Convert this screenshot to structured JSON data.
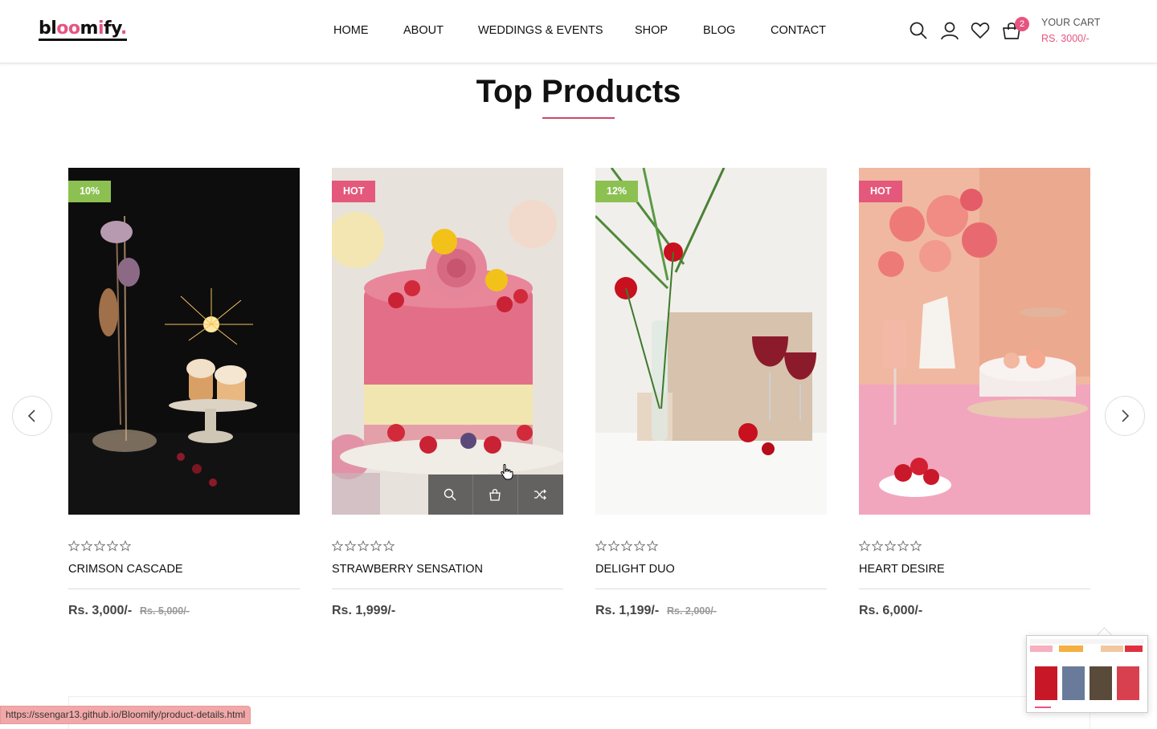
{
  "header": {
    "logo": {
      "part1": "bl",
      "part2": "oo",
      "part3": "m",
      "part4": "i",
      "part5": "fy",
      "part6": "."
    },
    "nav": [
      "HOME",
      "ABOUT",
      "WEDDINGS & EVENTS",
      "SHOP",
      "BLOG",
      "CONTACT"
    ],
    "cart": {
      "count": "2",
      "label": "YOUR CART",
      "total": "RS. 3000/-"
    },
    "icons": [
      "search-icon",
      "user-icon",
      "heart-icon",
      "bag-icon"
    ]
  },
  "section": {
    "title": "Top Products"
  },
  "colors": {
    "accent": "#e75480",
    "badge_green": "#8cc152",
    "badge_pink": "#e4587b"
  },
  "products": [
    {
      "badge": "10%",
      "name": "CRIMSON CASCADE",
      "price": "Rs. 3,000/-",
      "old_price": "Rs. 5,000/-",
      "rating": 0
    },
    {
      "badge": "HOT",
      "name": "STRAWBERRY SENSATION",
      "price": "Rs. 1,999/-",
      "old_price": "",
      "rating": 0
    },
    {
      "badge": "12%",
      "name": "DELIGHT DUO",
      "price": "Rs. 1,199/-",
      "old_price": "Rs. 2,000/-",
      "rating": 0
    },
    {
      "badge": "HOT",
      "name": "HEART DESIRE",
      "price": "Rs. 6,000/-",
      "old_price": "",
      "rating": 0
    }
  ],
  "status_url": "https://ssengar13.github.io/Bloomify/product-details.html"
}
